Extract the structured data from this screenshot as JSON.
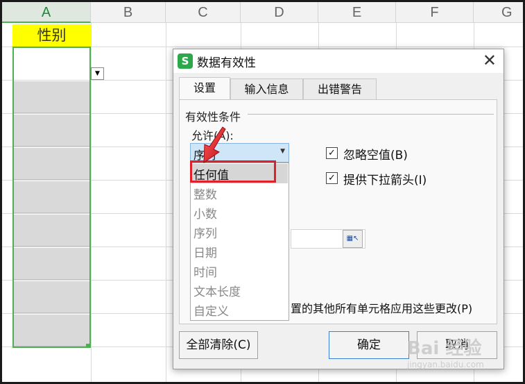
{
  "sheet": {
    "columns": [
      "A",
      "B",
      "C",
      "D",
      "E",
      "F",
      "G"
    ],
    "header_cell": "性别"
  },
  "dialog": {
    "app_icon": "S",
    "title": "数据有效性",
    "close": "✕",
    "tabs": [
      "设置",
      "输入信息",
      "出错警告"
    ],
    "group_label": "有效性条件",
    "allow_label": "允许(A):",
    "allow_selected": "序列",
    "allow_options": [
      "任何值",
      "整数",
      "小数",
      "序列",
      "日期",
      "时间",
      "文本长度",
      "自定义"
    ],
    "ignore_blank": "忽略空值(B)",
    "dropdown_arrow": "提供下拉箭头(I)",
    "apply_all": "置的其他所有单元格应用这些更改(P)",
    "clear_all": "全部清除(C)",
    "ok": "确定",
    "cancel": "取消"
  },
  "icons": {
    "cell_dropdown": "chevron-down-icon",
    "range_picker": "range-select-icon",
    "checkbox": "checkmark-icon",
    "annotation": "red-arrow-icon"
  },
  "colors": {
    "header_fill": "#ffff00",
    "selection_border": "#4caf50",
    "combo_fill": "#cfe6f8",
    "highlight_red": "#e0202a",
    "app_icon": "#2aa84a"
  },
  "watermark": {
    "text": "Bai 经验",
    "sub": "jingyan.baidu.com"
  }
}
